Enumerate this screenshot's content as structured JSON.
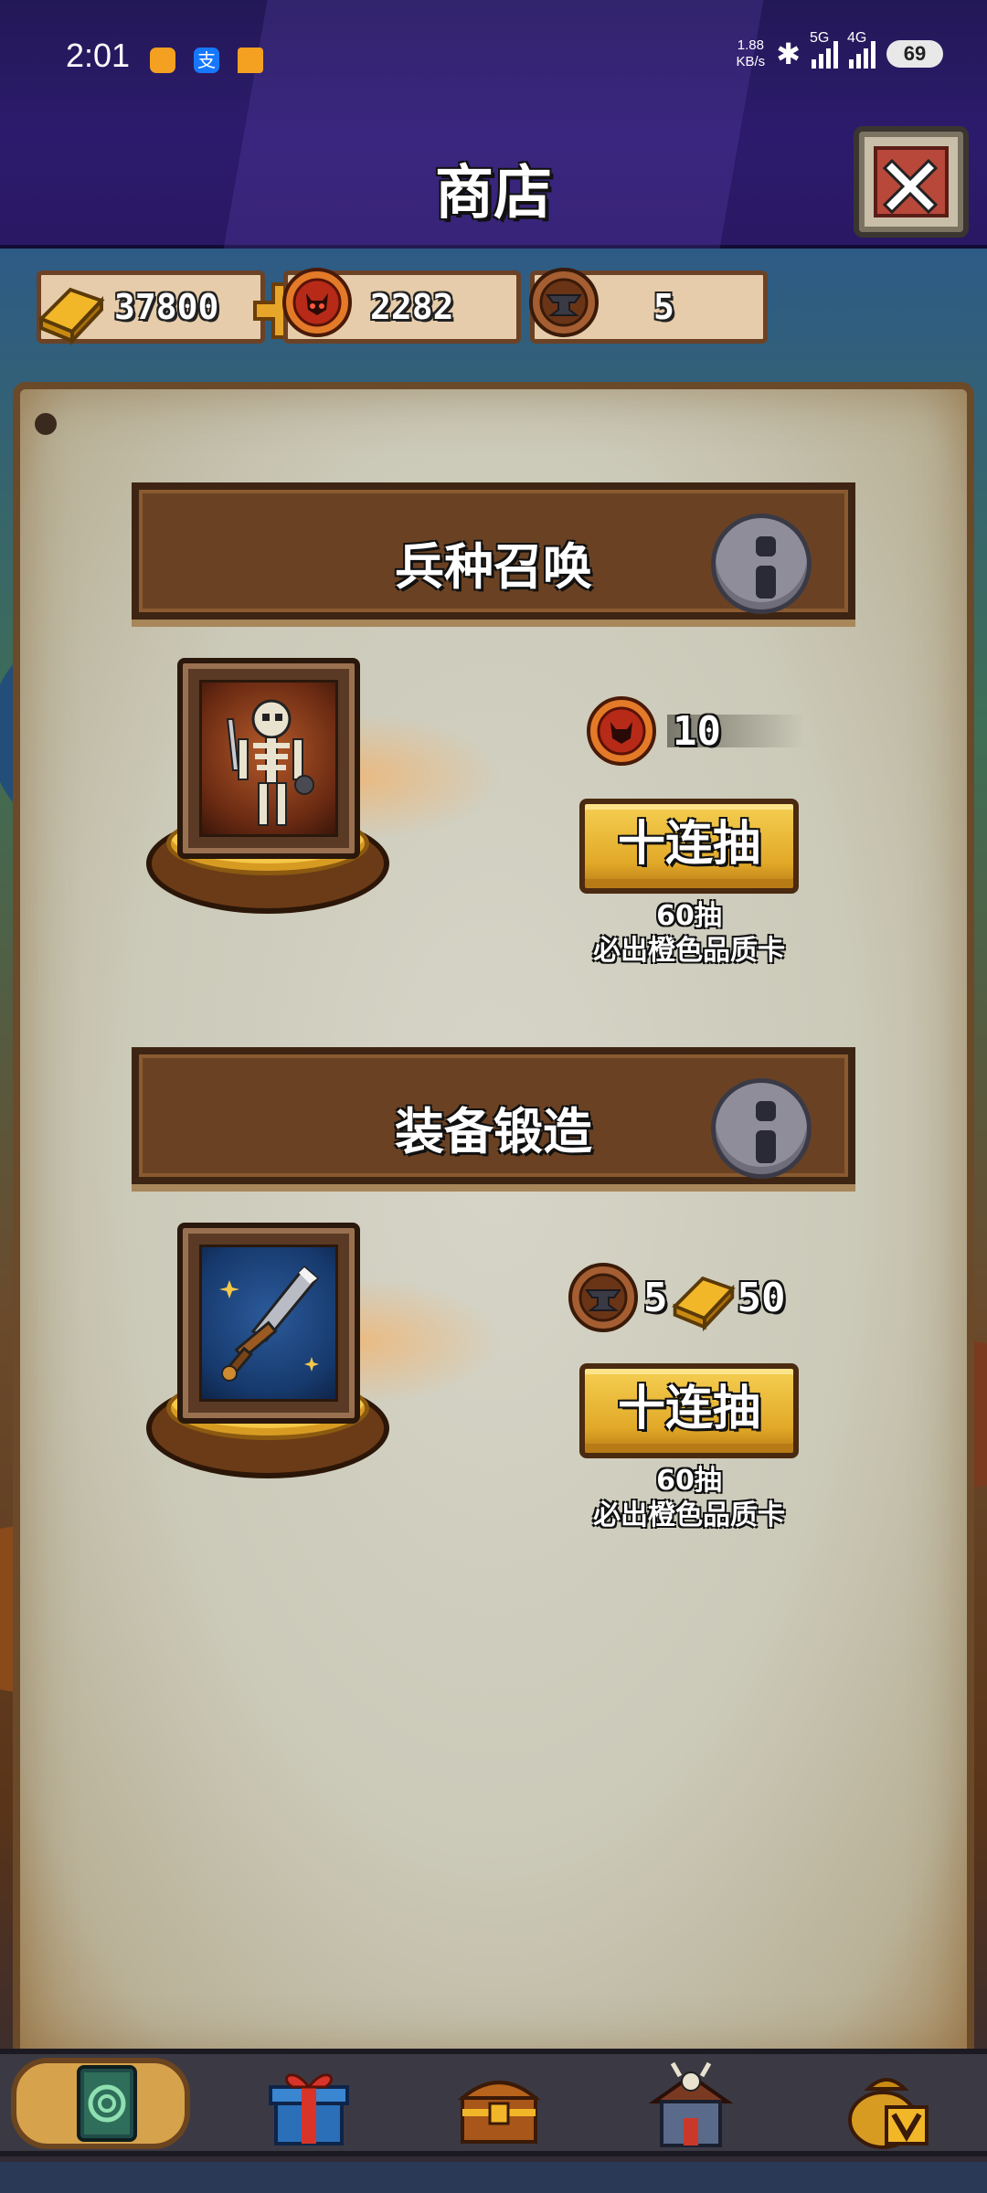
{
  "status_bar": {
    "time": "2:01",
    "net_speed_value": "1.88",
    "net_speed_unit": "KB/s",
    "signal_1": "5G",
    "signal_2": "4G",
    "battery": "69"
  },
  "header": {
    "title": "商店"
  },
  "currency": {
    "gold": "37800",
    "token": "2282",
    "anvil": "5"
  },
  "sections": [
    {
      "title": "兵种召唤",
      "cost_value": "10",
      "button_label": "十连抽",
      "guarantee_line1": "60抽",
      "guarantee_line2": "必出橙色品质卡",
      "icon": "skeleton-card"
    },
    {
      "title": "装备锻造",
      "cost_anvil": "5",
      "cost_gold": "50",
      "button_label": "十连抽",
      "guarantee_line1": "60抽",
      "guarantee_line2": "必出橙色品质卡",
      "icon": "sword-card"
    }
  ],
  "bottom_nav": {
    "items": [
      "card-deck-icon",
      "gift-icon",
      "treasure-chest-icon",
      "barracks-icon",
      "vip-bag-icon"
    ],
    "active_index": 0
  },
  "colors": {
    "header_bg": "#2c1b6c",
    "button_gold": "#e2a928",
    "panel_wood": "#6a4223"
  }
}
